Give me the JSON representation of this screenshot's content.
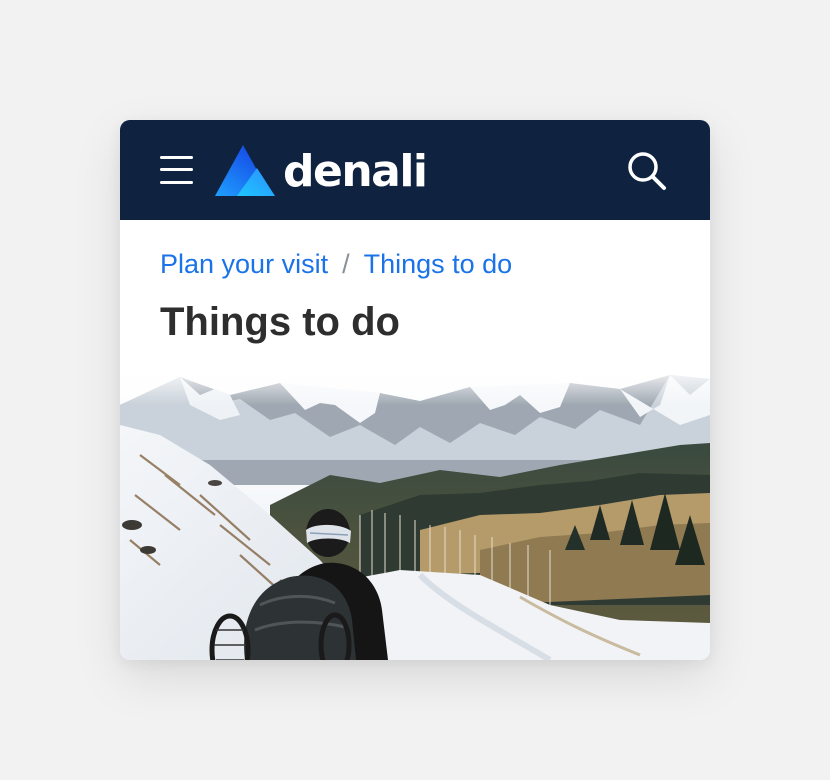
{
  "header": {
    "brand_name": "denali",
    "menu_icon": "hamburger-menu-icon",
    "search_icon": "search-icon",
    "background_color": "#0f2340"
  },
  "breadcrumb": {
    "items": [
      {
        "label": "Plan your visit"
      },
      {
        "label": "Things to do"
      }
    ],
    "separator": "/",
    "link_color": "#1a73e8"
  },
  "page": {
    "title": "Things to do"
  },
  "hero_image": {
    "description_icon": "snowy-mountain-hiker-photo"
  }
}
